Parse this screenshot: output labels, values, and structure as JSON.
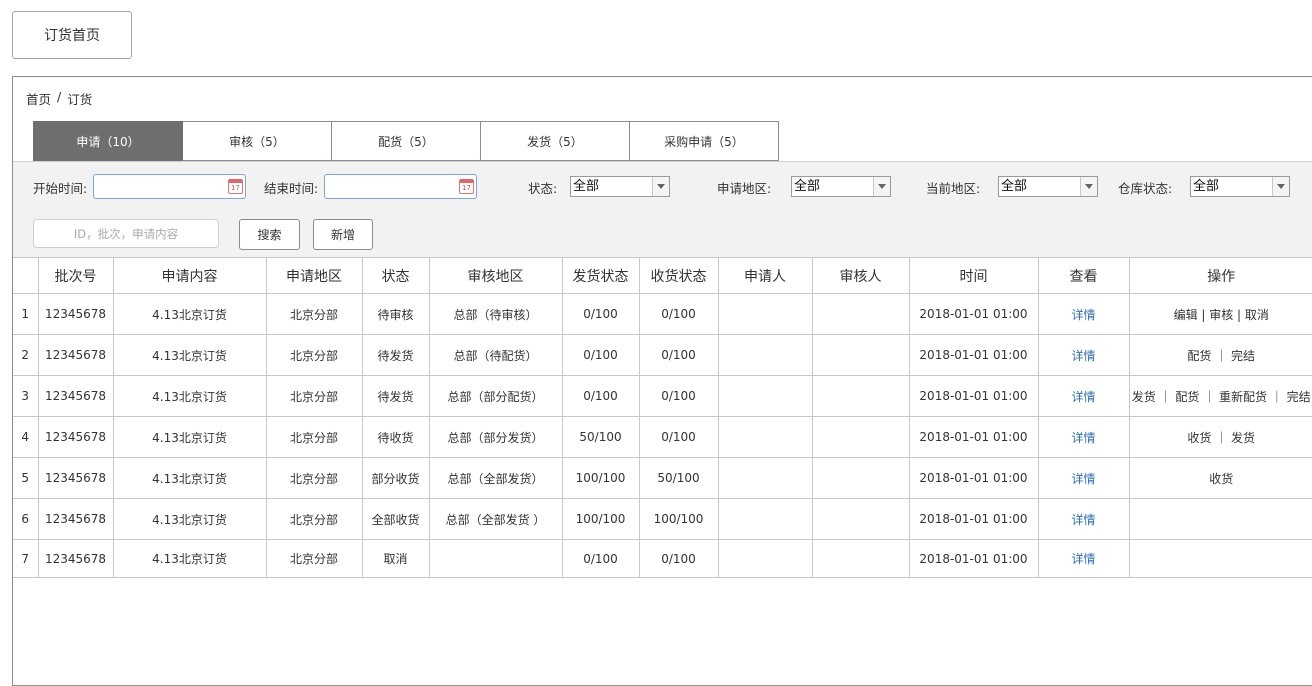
{
  "home_button": "订货首页",
  "breadcrumb": {
    "home": "首页",
    "sep": "/",
    "current": "订货"
  },
  "tabs": [
    {
      "label": "申请（10）"
    },
    {
      "label": "审核（5）"
    },
    {
      "label": "配货（5）"
    },
    {
      "label": "发货（5）"
    },
    {
      "label": "采购申请（5）"
    }
  ],
  "filters": {
    "start_label": "开始时间:",
    "end_label": "结束时间:",
    "status_label": "状态:",
    "status_value": "全部",
    "apply_region_label": "申请地区:",
    "apply_region_value": "全部",
    "current_region_label": "当前地区:",
    "current_region_value": "全部",
    "warehouse_label": "仓库状态:",
    "warehouse_value": "全部",
    "search_placeholder": "ID，批次，申请内容",
    "search_button": "搜索",
    "add_button": "新增"
  },
  "table": {
    "headers": [
      "",
      "批次号",
      "申请内容",
      "申请地区",
      "状态",
      "审核地区",
      "发货状态",
      "收货状态",
      "申请人",
      "审核人",
      "时间",
      "查看",
      "操作"
    ],
    "rows": [
      {
        "idx": "1",
        "batch": "12345678",
        "content": "4.13北京订货",
        "region": "北京分部",
        "status": "待审核",
        "audit": "总部（待审核）",
        "ship": "0/100",
        "recv": "0/100",
        "applicant": "",
        "auditor": "",
        "time": "2018-01-01 01:00",
        "view": "详情",
        "ops": "编辑 | 审核 | 取消"
      },
      {
        "idx": "2",
        "batch": "12345678",
        "content": "4.13北京订货",
        "region": "北京分部",
        "status": "待发货",
        "audit": "总部（待配货）",
        "ship": "0/100",
        "recv": "0/100",
        "applicant": "",
        "auditor": "",
        "time": "2018-01-01 01:00",
        "view": "详情",
        "ops": "配货 ｜ 完结"
      },
      {
        "idx": "3",
        "batch": "12345678",
        "content": "4.13北京订货",
        "region": "北京分部",
        "status": "待发货",
        "audit": "总部（部分配货）",
        "ship": "0/100",
        "recv": "0/100",
        "applicant": "",
        "auditor": "",
        "time": "2018-01-01 01:00",
        "view": "详情",
        "ops": "发货 ｜ 配货 ｜ 重新配货 ｜ 完结"
      },
      {
        "idx": "4",
        "batch": "12345678",
        "content": "4.13北京订货",
        "region": "北京分部",
        "status": "待收货",
        "audit": "总部（部分发货）",
        "ship": "50/100",
        "recv": "0/100",
        "applicant": "",
        "auditor": "",
        "time": "2018-01-01 01:00",
        "view": "详情",
        "ops": "收货 ｜ 发货"
      },
      {
        "idx": "5",
        "batch": "12345678",
        "content": "4.13北京订货",
        "region": "北京分部",
        "status": "部分收货",
        "audit": "总部（全部发货）",
        "ship": "100/100",
        "recv": "50/100",
        "applicant": "",
        "auditor": "",
        "time": "2018-01-01 01:00",
        "view": "详情",
        "ops": "收货"
      },
      {
        "idx": "6",
        "batch": "12345678",
        "content": "4.13北京订货",
        "region": "北京分部",
        "status": "全部收货",
        "audit": "总部（全部发货 ）",
        "ship": "100/100",
        "recv": "100/100",
        "applicant": "",
        "auditor": "",
        "time": "2018-01-01 01:00",
        "view": "详情",
        "ops": ""
      },
      {
        "idx": "7",
        "batch": "12345678",
        "content": "4.13北京订货",
        "region": "北京分部",
        "status": "取消",
        "audit": "",
        "ship": "0/100",
        "recv": "0/100",
        "applicant": "",
        "auditor": "",
        "time": "2018-01-01 01:00",
        "view": "详情",
        "ops": ""
      }
    ]
  },
  "colors": {
    "tab_active_bg": "#6e6e6e",
    "link": "#2f6fb5",
    "filter_bg": "#f2f2f2"
  },
  "icons": {
    "calendar": "calendar-icon",
    "dropdown": "chevron-down-icon"
  }
}
